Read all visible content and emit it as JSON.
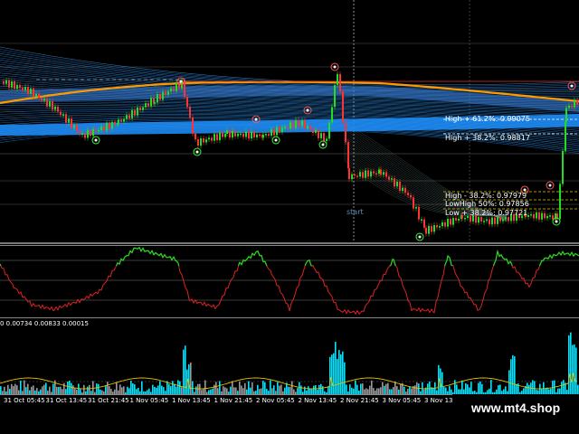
{
  "chart": {
    "fib_levels": [
      {
        "label": "High + 61.2%: 0.99075"
      },
      {
        "label": "High + 38.2%: 0.98817"
      },
      {
        "label": "High - 38.2%: 0.97979"
      },
      {
        "label": "LowHigh 50%: 0.97856"
      },
      {
        "label": "Low + 38.2%: 0.97721"
      }
    ],
    "start_label": "start",
    "histogram_readout": "0 0.00734 0.00833 0.00015",
    "time_ticks": [
      "31 Oct 05:45",
      "31 Oct 13:45",
      "31 Oct 21:45",
      "1 Nov 05:45",
      "1 Nov 13:45",
      "1 Nov 21:45",
      "2 Nov 05:45",
      "2 Nov 13:45",
      "2 Nov 21:45",
      "3 Nov 05:45",
      "3 Nov 13:45",
      "3 Nov 21:45",
      "4 Nov 05:45",
      "4 Nov 13:45"
    ],
    "watermark": "www.mt4.shop",
    "colors": {
      "candles_up": "#22dd22",
      "candles_down": "#ff3333",
      "band": "#1e90ff",
      "band_light": "#5ab4ff",
      "ma": "#ff9900",
      "osc_high": "#22dd22",
      "osc_low": "#dd2222",
      "hist_main": "#00e5ff",
      "hist_alt": "#999999",
      "hist_line": "#e6c200"
    }
  }
}
